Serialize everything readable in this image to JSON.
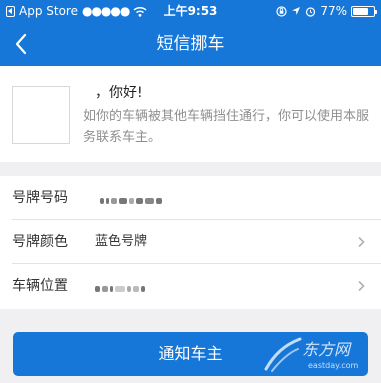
{
  "status_bar": {
    "carrier": "App Store",
    "signal": "●●●●●",
    "time": "上午9:53",
    "battery_percent": "77%",
    "battery_level": 0.77
  },
  "nav": {
    "title": "短信挪车"
  },
  "intro": {
    "greeting": "，你好!",
    "description": "如你的车辆被其他车辆挡住通行，你可以使用本服务联系车主。"
  },
  "form": {
    "plate_number_label": "号牌号码",
    "plate_color_label": "号牌颜色",
    "plate_color_value": "蓝色号牌",
    "vehicle_location_label": "车辆位置"
  },
  "button": {
    "notify_label": "通知车主"
  },
  "watermark": {
    "text": "东方网",
    "domain": "eastday.com"
  },
  "colors": {
    "brand_blue": "#1677d9",
    "page_background": "#f0f0f3"
  }
}
